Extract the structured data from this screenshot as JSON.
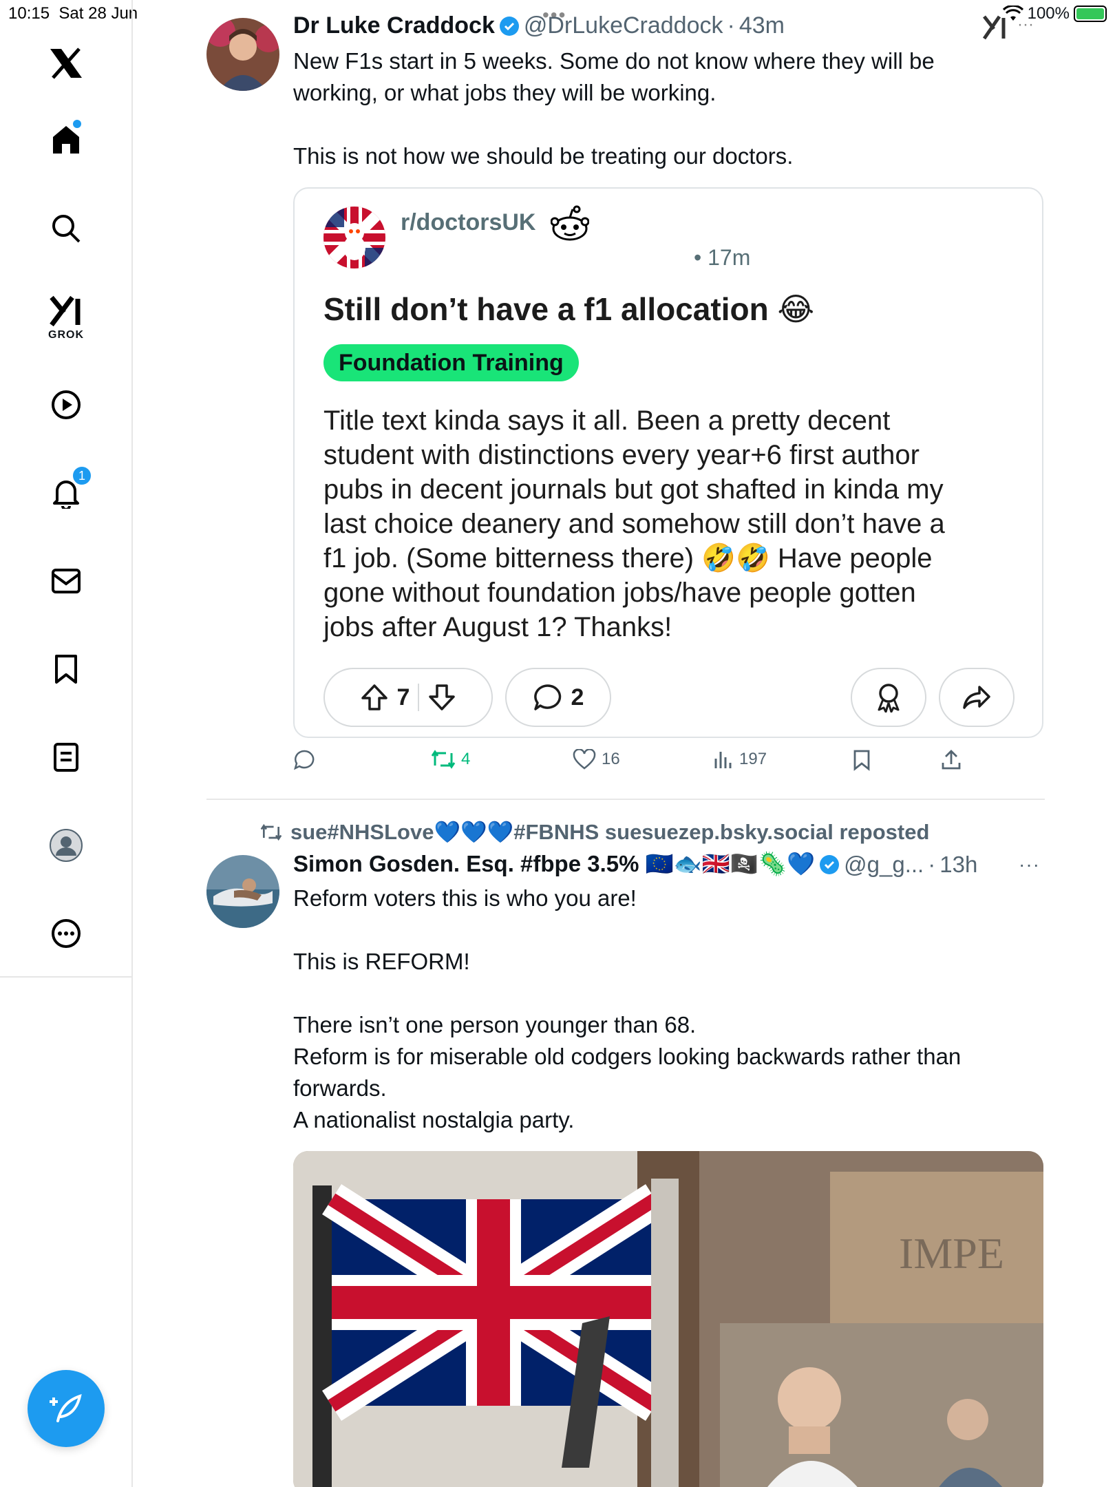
{
  "status_bar": {
    "time": "10:15",
    "date": "Sat 28 Jun",
    "battery": "100%"
  },
  "sidebar": {
    "logo": "x-logo-icon",
    "items": [
      {
        "name": "home",
        "icon": "home-icon",
        "badge_dot": true
      },
      {
        "name": "search",
        "icon": "search-icon"
      },
      {
        "name": "grok",
        "icon": "grok-icon",
        "label": "GROK"
      },
      {
        "name": "video",
        "icon": "play-icon"
      },
      {
        "name": "notifications",
        "icon": "bell-icon",
        "badge": "1"
      },
      {
        "name": "messages",
        "icon": "mail-icon"
      },
      {
        "name": "bookmarks",
        "icon": "bookmark-icon"
      },
      {
        "name": "lists",
        "icon": "list-icon"
      },
      {
        "name": "profile",
        "icon": "person-icon"
      },
      {
        "name": "more",
        "icon": "more-icon"
      }
    ],
    "compose_icon": "compose-icon"
  },
  "tweet1": {
    "name": "Dr Luke Craddock",
    "handle": "@DrLukeCraddock",
    "sep": "·",
    "time": "43m",
    "text": "New F1s start in 5 weeks. Some do not know where they will be\nworking, or what jobs they will be working.\n\nThis is not how we should be treating our doctors.",
    "embed": {
      "subreddit": "r/doctorsUK",
      "time": "• 17m",
      "title": "Still don’t have a f1 allocation 😂",
      "flair": "Foundation Training",
      "body": "Title text kinda says it all. Been a pretty decent\nstudent with distinctions every year+6 first author\npubs in decent journals but got shafted in kinda my\nlast choice deanery and somehow still don’t have a\nf1 job. (Some bitterness there) 🤣🤣 Have people\ngone without foundation jobs/have people gotten\njobs after August 1? Thanks!",
      "upvotes": "7",
      "comments": "2"
    },
    "actions": {
      "reposts": "4",
      "likes": "16",
      "views": "197"
    }
  },
  "tweet2": {
    "repost_by": "sue#NHSLove💙💙💙#FBNHS suesuezep.bsky.social reposted",
    "name": "Simon Gosden. Esq. #fbpe 3.5% 🇪🇺🐟🇬🇧🏴‍☠️🦠💙",
    "handle": "@g_g...",
    "sep": "·",
    "time": "13h",
    "text": "Reform voters this is who you are!\n\nThis is REFORM!\n\nThere isn’t one person younger than 68.\nReform is for miserable old codgers looking backwards rather than\nforwards.\nA nationalist nostalgia party.",
    "media_sign": "IMPE"
  },
  "colors": {
    "accent": "#1d9bf0",
    "repost_green": "#00ba7c",
    "flair_green": "#19e478"
  }
}
